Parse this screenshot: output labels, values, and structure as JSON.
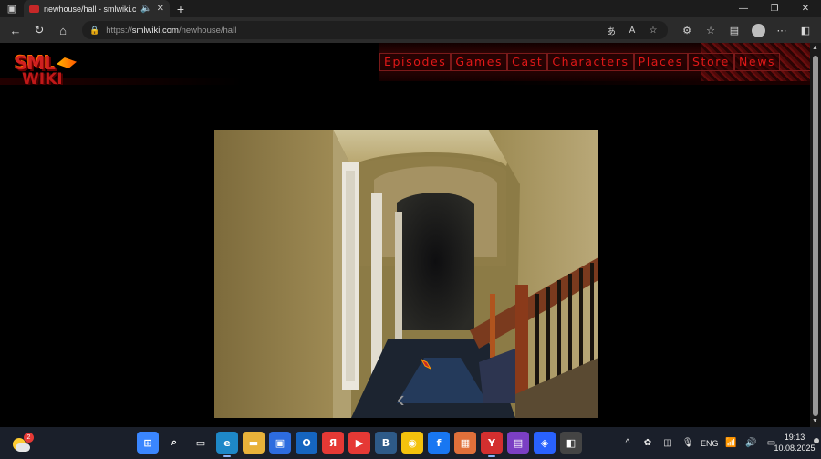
{
  "browser": {
    "tab": {
      "title": "newhouse/hall - smlwiki.com"
    },
    "address": {
      "scheme": "https://",
      "host": "smlwiki.com",
      "path": "/newhouse/hall"
    }
  },
  "site": {
    "logo": {
      "line1": "SML",
      "line2": "WIKI"
    },
    "nav": [
      "Episodes",
      "Games",
      "Cast",
      "Characters",
      "Places",
      "Store",
      "News"
    ]
  },
  "taskbar": {
    "weather_badge": "2",
    "apps": [
      {
        "name": "start",
        "glyph": "⊞",
        "color": "#3a86ff"
      },
      {
        "name": "search",
        "glyph": "⌕",
        "color": "transparent"
      },
      {
        "name": "task-view",
        "glyph": "▭",
        "color": "transparent"
      },
      {
        "name": "edge",
        "glyph": "e",
        "color": "#1e88c8"
      },
      {
        "name": "file-explorer",
        "glyph": "▬",
        "color": "#e8b23a"
      },
      {
        "name": "store",
        "glyph": "▣",
        "color": "#2d6cdf"
      },
      {
        "name": "outlook",
        "glyph": "O",
        "color": "#1565c0"
      },
      {
        "name": "yandex",
        "glyph": "Я",
        "color": "#e53935"
      },
      {
        "name": "youtube",
        "glyph": "▶",
        "color": "#e53935"
      },
      {
        "name": "vk",
        "glyph": "B",
        "color": "#2e5a88"
      },
      {
        "name": "beeline",
        "glyph": "◉",
        "color": "#f4c20d"
      },
      {
        "name": "facebook",
        "glyph": "f",
        "color": "#1877f2"
      },
      {
        "name": "app-orange",
        "glyph": "▦",
        "color": "#e0703a"
      },
      {
        "name": "yandex-browser",
        "glyph": "Y",
        "color": "#d32f2f"
      },
      {
        "name": "app-purple",
        "glyph": "▤",
        "color": "#7b3fc4"
      },
      {
        "name": "app-blue",
        "glyph": "◈",
        "color": "#2962ff"
      },
      {
        "name": "app-roblox",
        "glyph": "◧",
        "color": "#444"
      }
    ],
    "tray": {
      "lang": "ENG"
    },
    "clock": {
      "time": "19:13",
      "date": "10.08.2025"
    }
  }
}
